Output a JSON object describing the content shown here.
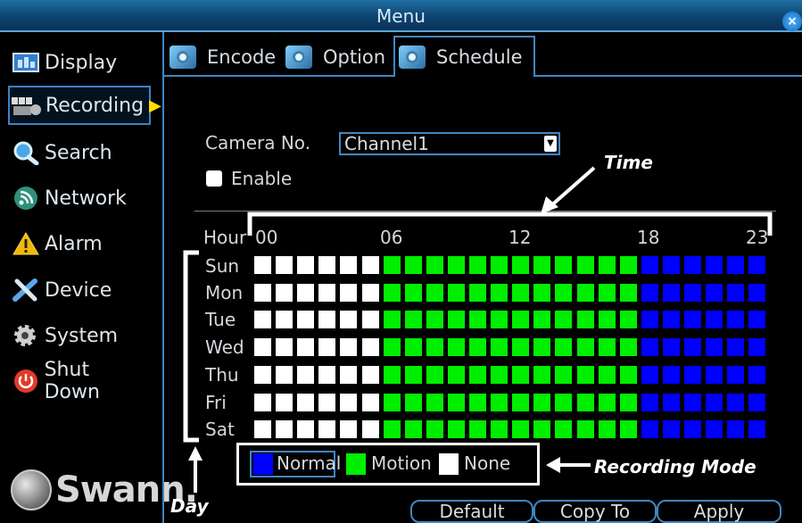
{
  "window": {
    "title": "Menu",
    "close_icon": "×"
  },
  "sidebar": {
    "items": [
      {
        "label": "Display",
        "icon": "display-icon"
      },
      {
        "label": "Recording",
        "icon": "recording-icon",
        "active": true
      },
      {
        "label": "Search",
        "icon": "search-icon"
      },
      {
        "label": "Network",
        "icon": "network-icon"
      },
      {
        "label": "Alarm",
        "icon": "alarm-icon"
      },
      {
        "label": "Device",
        "icon": "device-icon"
      },
      {
        "label": "System",
        "icon": "system-icon"
      },
      {
        "label": "Shut Down",
        "icon": "shutdown-icon"
      }
    ],
    "logo_text": "Swann."
  },
  "tabs": [
    {
      "label": "Encode"
    },
    {
      "label": "Option"
    },
    {
      "label": "Schedule",
      "active": true
    }
  ],
  "schedule": {
    "camera_label": "Camera No.",
    "camera_value": "Channel1",
    "enable_label": "Enable",
    "enable_checked": false,
    "hour_label": "Hour",
    "hour_ticks": [
      "00",
      "06",
      "12",
      "18",
      "23"
    ],
    "days": [
      "Sun",
      "Mon",
      "Tue",
      "Wed",
      "Thu",
      "Fri",
      "Sat"
    ],
    "hours_per_day": 24,
    "row_pattern": [
      "none",
      "none",
      "none",
      "none",
      "none",
      "none",
      "motion",
      "motion",
      "motion",
      "motion",
      "motion",
      "motion",
      "motion",
      "motion",
      "motion",
      "motion",
      "motion",
      "motion",
      "normal",
      "normal",
      "normal",
      "normal",
      "normal",
      "normal"
    ],
    "colors": {
      "none": "#ffffff",
      "motion": "#00ee00",
      "normal": "#0000ff"
    }
  },
  "legend": [
    {
      "label": "Normal",
      "color": "#0000ff"
    },
    {
      "label": "Motion",
      "color": "#00ee00"
    },
    {
      "label": "None",
      "color": "#ffffff"
    }
  ],
  "buttons": {
    "default": "Default",
    "copy_to": "Copy To",
    "apply": "Apply"
  },
  "annotations": {
    "time": "Time",
    "day": "Day",
    "recording_mode": "Recording Mode"
  }
}
